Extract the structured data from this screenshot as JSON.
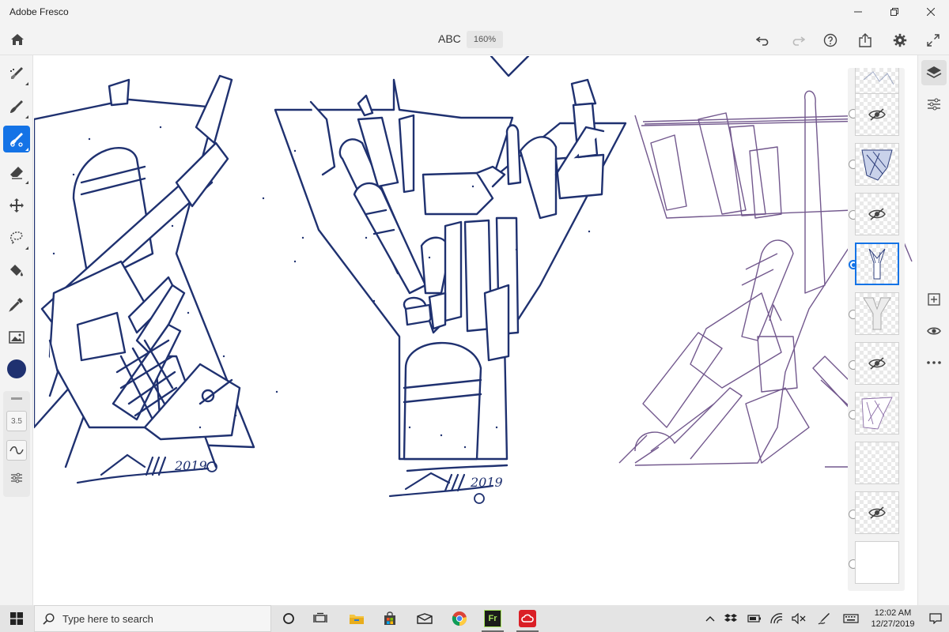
{
  "window": {
    "title": "Adobe Fresco"
  },
  "toolbar": {
    "document_title": "ABC",
    "zoom": "160%"
  },
  "brush": {
    "size": "3.5"
  },
  "colors": {
    "accent": "#1473e6",
    "current_color": "#1f3170",
    "ink_blue": "#1f3170",
    "sketch_purple": "#5a3b7a"
  },
  "layers": [
    {
      "hidden": false,
      "selected": false,
      "kind": "sketch"
    },
    {
      "hidden": true,
      "selected": false,
      "kind": "art"
    },
    {
      "hidden": false,
      "selected": false,
      "kind": "color-art"
    },
    {
      "hidden": true,
      "selected": false,
      "kind": "art"
    },
    {
      "hidden": false,
      "selected": true,
      "kind": "art"
    },
    {
      "hidden": false,
      "selected": false,
      "kind": "letter-y"
    },
    {
      "hidden": true,
      "selected": false,
      "kind": "art"
    },
    {
      "hidden": false,
      "selected": false,
      "kind": "purple-sketch"
    },
    {
      "hidden": false,
      "selected": false,
      "kind": "empty"
    },
    {
      "hidden": true,
      "selected": false,
      "kind": "art"
    },
    {
      "hidden": false,
      "selected": false,
      "kind": "background"
    }
  ],
  "taskbar": {
    "search_placeholder": "Type here to search",
    "time": "12:02 AM",
    "date": "12/27/2019",
    "fresco_label": "Fr"
  },
  "canvas": {
    "signature_left_year": "2019",
    "signature_mid_year": "2019"
  }
}
